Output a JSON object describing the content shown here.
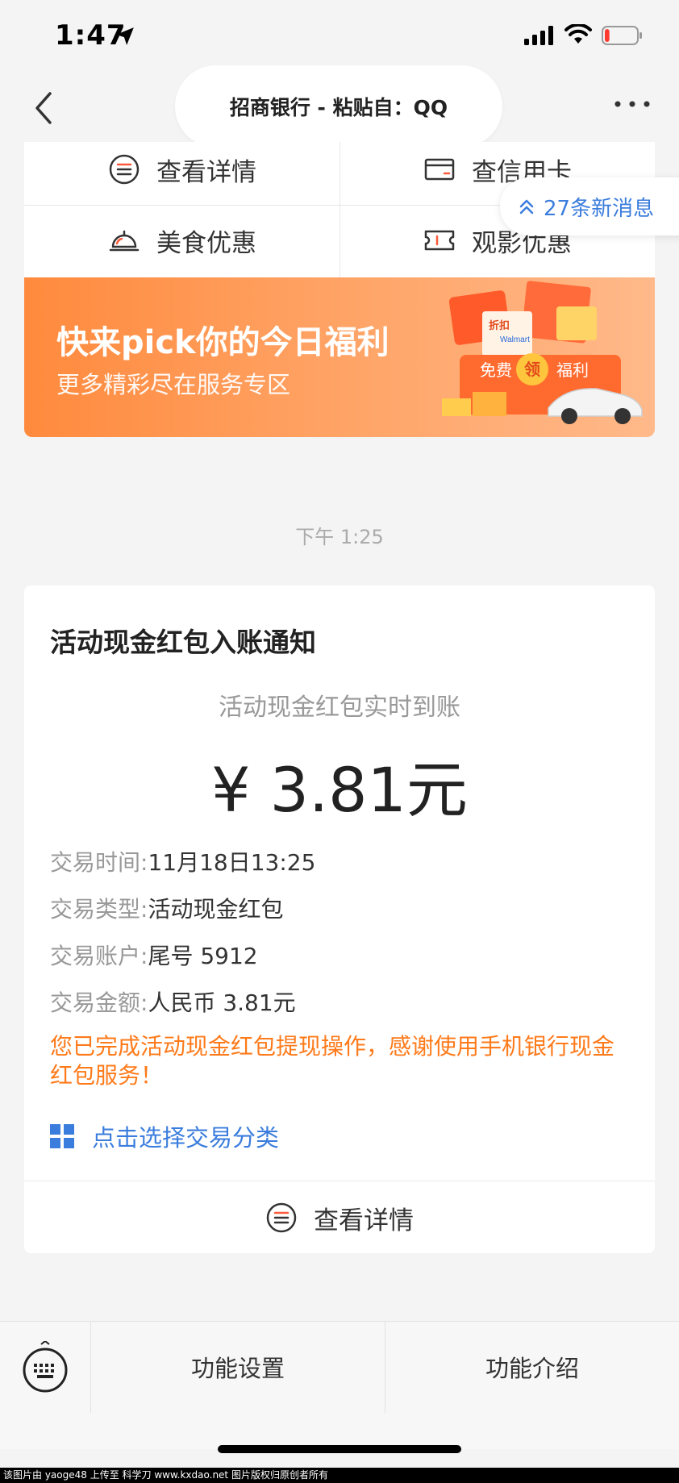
{
  "status_bar": {
    "time": "1:47",
    "battery_level": 0.15,
    "colors": {
      "battery_low": "#ff3b30"
    }
  },
  "nav": {
    "title": "招商银行 - 粘贴自：QQ",
    "back_icon": "chevron-left-icon",
    "more_icon": "more-dots-icon"
  },
  "menu": {
    "items": [
      {
        "label": "查看详情",
        "icon": "list-circle-icon"
      },
      {
        "label": "查信用卡",
        "icon": "credit-card-icon"
      },
      {
        "label": "美食优惠",
        "icon": "food-bell-icon"
      },
      {
        "label": "观影优惠",
        "icon": "ticket-icon"
      }
    ]
  },
  "new_messages": {
    "label": "27条新消息",
    "icon": "double-chevron-up-icon",
    "color": "#3b7ddd"
  },
  "banner": {
    "title": "快来pick你的今日福利",
    "subtitle": "更多精彩尽在服务专区",
    "art_texts": {
      "discount": "折扣",
      "brand": "Walmart",
      "free": "免费",
      "claim": "领",
      "welfare": "福利"
    }
  },
  "timestamp": "下午 1:25",
  "message": {
    "title": "活动现金红包入账通知",
    "subtitle": "活动现金红包实时到账",
    "amount": "¥ 3.81元",
    "details": [
      {
        "label": "交易时间:",
        "value": "11月18日13:25"
      },
      {
        "label": "交易类型:",
        "value": "活动现金红包"
      },
      {
        "label": "交易账户:",
        "value": "尾号 5912"
      },
      {
        "label": "交易金额:",
        "value": "人民币 3.81元"
      }
    ],
    "note": "您已完成活动现金红包提现操作，感谢使用手机银行现金红包服务！",
    "category_link": "点击选择交易分类",
    "detail_button": "查看详情",
    "colors": {
      "note": "#ff7a1a",
      "link": "#3b7ddd"
    }
  },
  "bottom_bar": {
    "settings": "功能设置",
    "intro": "功能介绍",
    "keyboard_icon": "keyboard-icon"
  },
  "watermark": "该图片由 yaoge48 上传至 科学刀 www.kxdao.net 图片版权归原创者所有"
}
